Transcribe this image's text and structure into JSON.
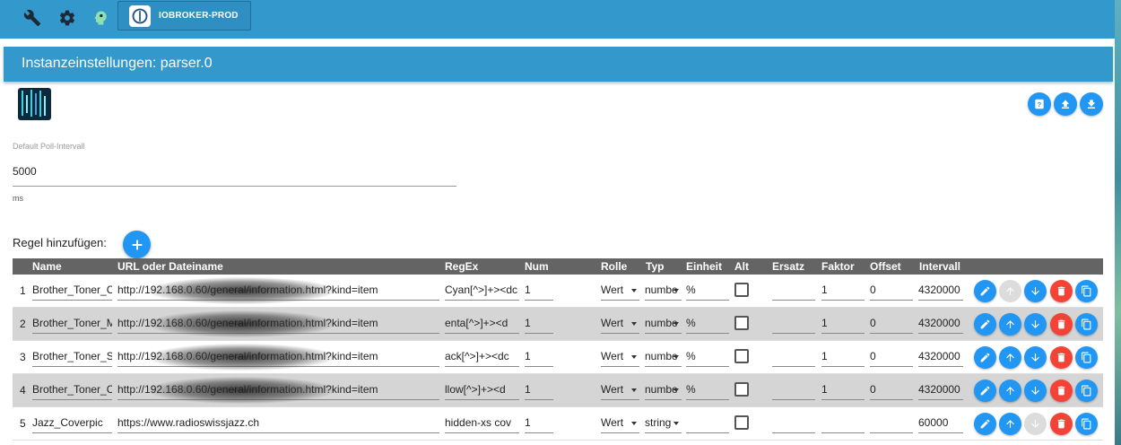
{
  "topbar": {
    "icons": [
      "wrench-icon",
      "gear-icon",
      "head-icon"
    ],
    "host_label": "IOBROKER-PROD"
  },
  "header": {
    "title": "Instanzeinstellungen: parser.0"
  },
  "toolbar_icons": [
    "help-icon",
    "upload-icon",
    "download-icon"
  ],
  "settings": {
    "poll_label": "Default Poll-Intervall",
    "poll_value": "5000",
    "poll_unit": "ms",
    "add_rule_label": "Regel hinzufügen:"
  },
  "table": {
    "columns": [
      "Name",
      "URL oder Dateiname",
      "RegEx",
      "Num",
      "Rolle",
      "Typ",
      "Einheit",
      "Alt",
      "Ersatz",
      "Faktor",
      "Offset",
      "Intervall"
    ],
    "rows": [
      {
        "idx": "1",
        "name": "Brother_Toner_C",
        "url": "http://192.168.0.60/general/information.html?kind=item",
        "regex": "Cyan[^>]+><dc",
        "num": "1",
        "role": "Wert",
        "type": "numbe",
        "unit": "%",
        "alt": false,
        "replace": "",
        "factor": "1",
        "offset": "0",
        "interval": "4320000",
        "up_disabled": true,
        "down_disabled": false
      },
      {
        "idx": "2",
        "name": "Brother_Toner_M",
        "url": "http://192.168.0.60/general/information.html?kind=item",
        "regex": "enta[^>]+><d",
        "num": "1",
        "role": "Wert",
        "type": "numbe",
        "unit": "%",
        "alt": false,
        "replace": "",
        "factor": "1",
        "offset": "0",
        "interval": "4320000",
        "up_disabled": false,
        "down_disabled": false
      },
      {
        "idx": "3",
        "name": "Brother_Toner_S",
        "url": "http://192.168.0.60/general/information.html?kind=item",
        "regex": "ack[^>]+><dc",
        "num": "1",
        "role": "Wert",
        "type": "numbe",
        "unit": "%",
        "alt": false,
        "replace": "",
        "factor": "1",
        "offset": "0",
        "interval": "4320000",
        "up_disabled": false,
        "down_disabled": false
      },
      {
        "idx": "4",
        "name": "Brother_Toner_C",
        "url": "http://192.168.0.60/general/information.html?kind=item",
        "regex": "llow[^>]+><d",
        "num": "1",
        "role": "Wert",
        "type": "numbe",
        "unit": "%",
        "alt": false,
        "replace": "",
        "factor": "1",
        "offset": "0",
        "interval": "4320000",
        "up_disabled": false,
        "down_disabled": false
      },
      {
        "idx": "5",
        "name": "Jazz_Coverpic",
        "url": "https://www.radioswissjazz.ch",
        "regex": " hidden-xs cov",
        "num": "1",
        "role": "Wert",
        "type": "string",
        "unit": "",
        "alt": false,
        "replace": "",
        "factor": "",
        "offset": "",
        "interval": "60000",
        "up_disabled": false,
        "down_disabled": true
      }
    ]
  },
  "colors": {
    "primary": "#3399cc",
    "button_blue": "#2196f3",
    "button_red": "#f44336",
    "header_grey": "#646464"
  }
}
